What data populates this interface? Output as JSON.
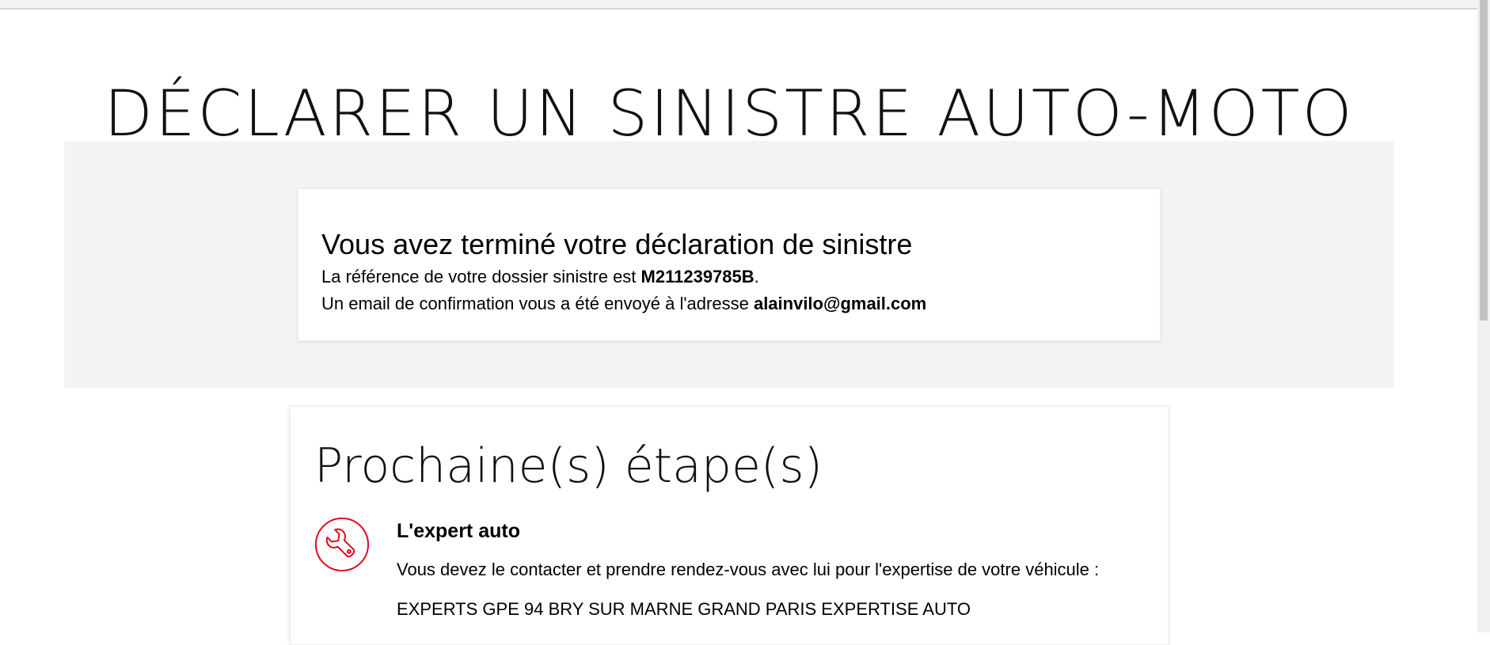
{
  "page": {
    "title": "DÉCLARER UN SINISTRE AUTO-MOTO"
  },
  "confirmation": {
    "heading": "Vous avez terminé votre déclaration de sinistre",
    "reference_prefix": "La référence de votre dossier sinistre est ",
    "reference_value": "M211239785B",
    "reference_suffix": ".",
    "email_prefix": "Un email de confirmation vous a été envoyé à l'adresse ",
    "email_value": "alainvilo@gmail.com"
  },
  "next_steps": {
    "title": "Prochaine(s) étape(s)",
    "items": [
      {
        "icon": "wrench-icon",
        "title": "L'expert auto",
        "text": "Vous devez le contacter et prendre rendez-vous avec lui pour l'expertise de votre véhicule :",
        "expert_name": "EXPERTS GPE 94 BRY SUR MARNE GRAND PARIS EXPERTISE AUTO"
      }
    ]
  },
  "colors": {
    "accent": "#e2001a",
    "band_background": "#f2f3f5"
  }
}
